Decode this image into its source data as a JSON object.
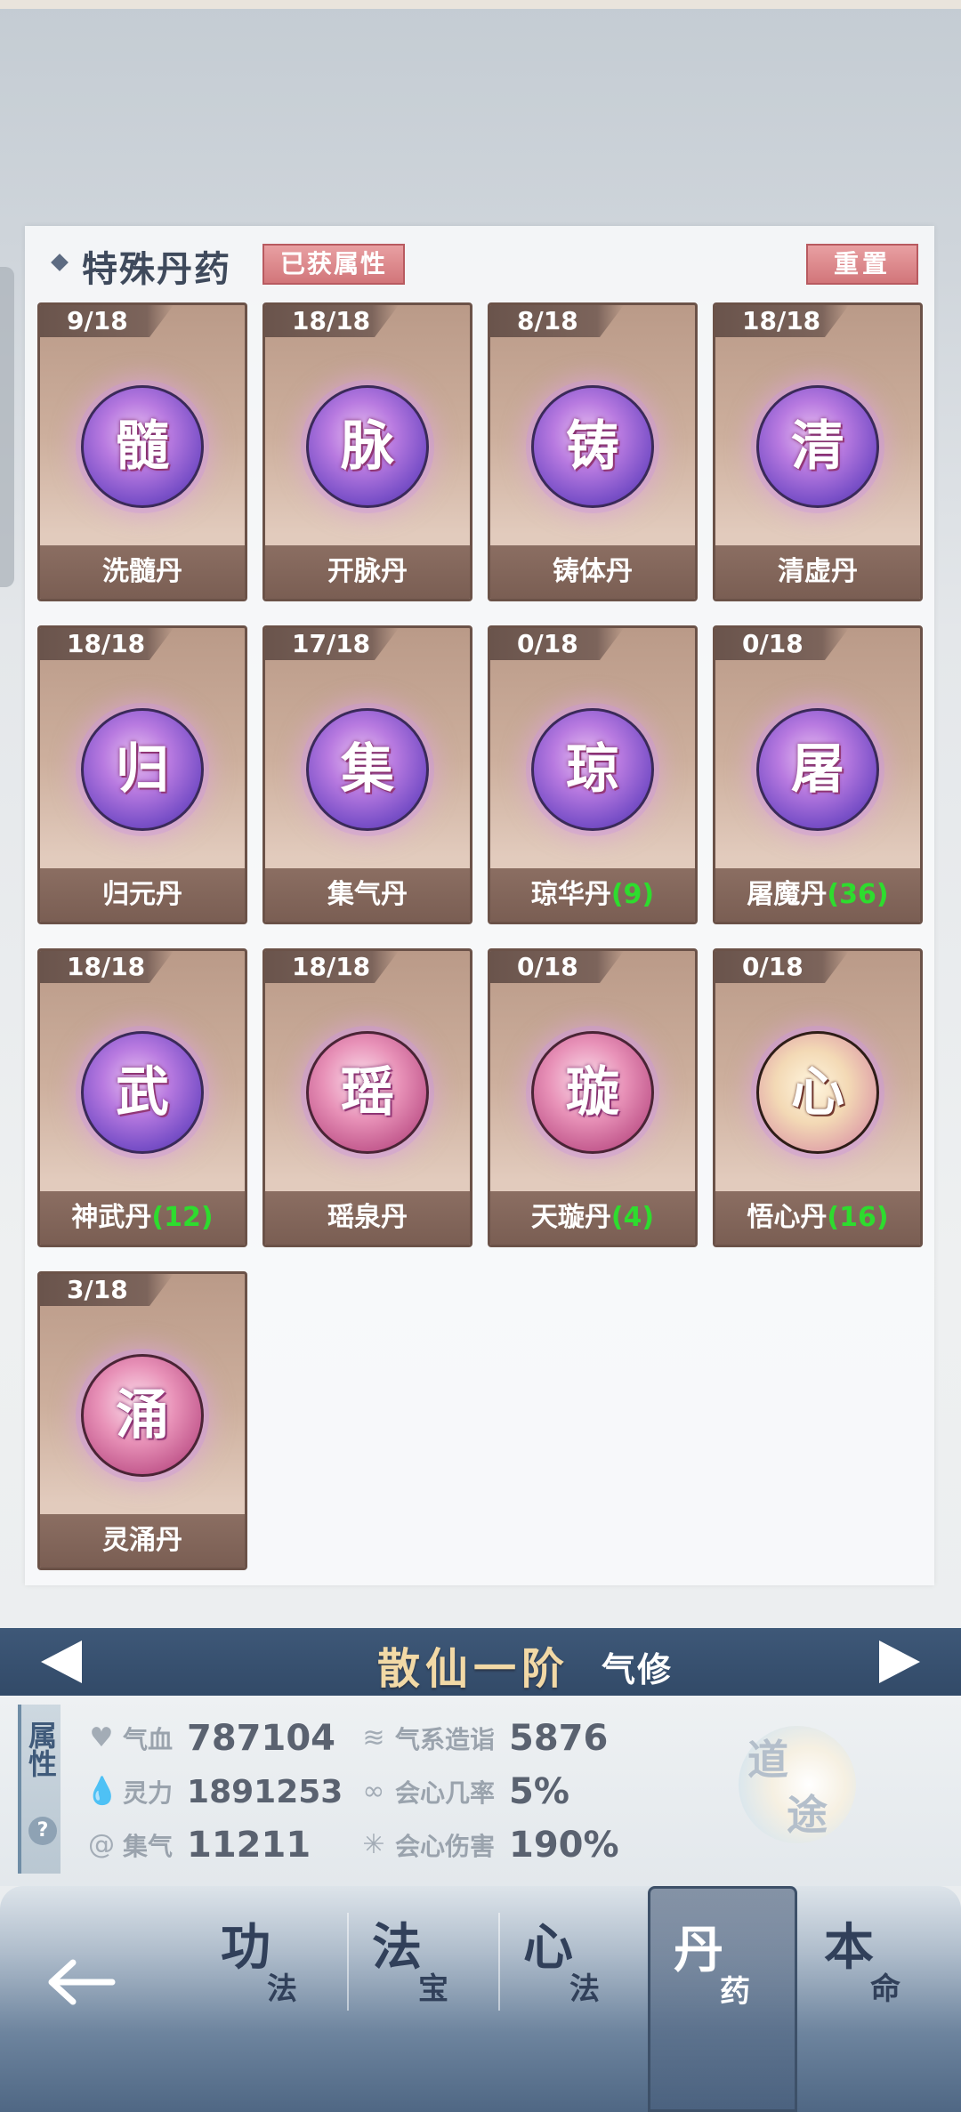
{
  "panel": {
    "title": "特殊丹药",
    "attr_button": "已获属性",
    "reset_button": "重置"
  },
  "pills": [
    {
      "count": "9/18",
      "glyph": "髓",
      "name": "洗髓丹",
      "extra": "",
      "style": "purple"
    },
    {
      "count": "18/18",
      "glyph": "脉",
      "name": "开脉丹",
      "extra": "",
      "style": "purple"
    },
    {
      "count": "8/18",
      "glyph": "铸",
      "name": "铸体丹",
      "extra": "",
      "style": "purple"
    },
    {
      "count": "18/18",
      "glyph": "清",
      "name": "清虚丹",
      "extra": "",
      "style": "purple"
    },
    {
      "count": "18/18",
      "glyph": "归",
      "name": "归元丹",
      "extra": "",
      "style": "purple"
    },
    {
      "count": "17/18",
      "glyph": "集",
      "name": "集气丹",
      "extra": "",
      "style": "purple"
    },
    {
      "count": "0/18",
      "glyph": "琼",
      "name": "琼华丹",
      "extra": "(9)",
      "style": "purple"
    },
    {
      "count": "0/18",
      "glyph": "屠",
      "name": "屠魔丹",
      "extra": "(36)",
      "style": "purple"
    },
    {
      "count": "18/18",
      "glyph": "武",
      "name": "神武丹",
      "extra": "(12)",
      "style": "purple"
    },
    {
      "count": "18/18",
      "glyph": "瑶",
      "name": "瑶泉丹",
      "extra": "",
      "style": "pink"
    },
    {
      "count": "0/18",
      "glyph": "璇",
      "name": "天璇丹",
      "extra": "(4)",
      "style": "pink"
    },
    {
      "count": "0/18",
      "glyph": "心",
      "name": "悟心丹",
      "extra": "(16)",
      "style": "gold"
    },
    {
      "count": "3/18",
      "glyph": "涌",
      "name": "灵涌丹",
      "extra": "",
      "style": "pink"
    }
  ],
  "realm": {
    "title": "散仙一阶",
    "subtitle": "气修"
  },
  "stats": {
    "tab_label": "属性",
    "help": "?",
    "items": [
      {
        "label": "气血",
        "value": "787104",
        "icon": "heart-icon"
      },
      {
        "label": "灵力",
        "value": "1891253",
        "icon": "drop-icon"
      },
      {
        "label": "集气",
        "value": "11211",
        "icon": "swirl-icon"
      },
      {
        "label": "气系造诣",
        "value": "5876",
        "icon": "wind-icon"
      },
      {
        "label": "会心几率",
        "value": "5%",
        "icon": "crit-rate-icon"
      },
      {
        "label": "会心伤害",
        "value": "190%",
        "icon": "burst-icon"
      }
    ],
    "dao": [
      "道",
      "途"
    ]
  },
  "nav": {
    "tabs": [
      {
        "big": "功",
        "small": "法"
      },
      {
        "big": "法",
        "small": "宝"
      },
      {
        "big": "心",
        "small": "法"
      },
      {
        "big": "丹",
        "small": "药"
      },
      {
        "big": "本",
        "small": "命"
      }
    ],
    "active_index": 3
  }
}
